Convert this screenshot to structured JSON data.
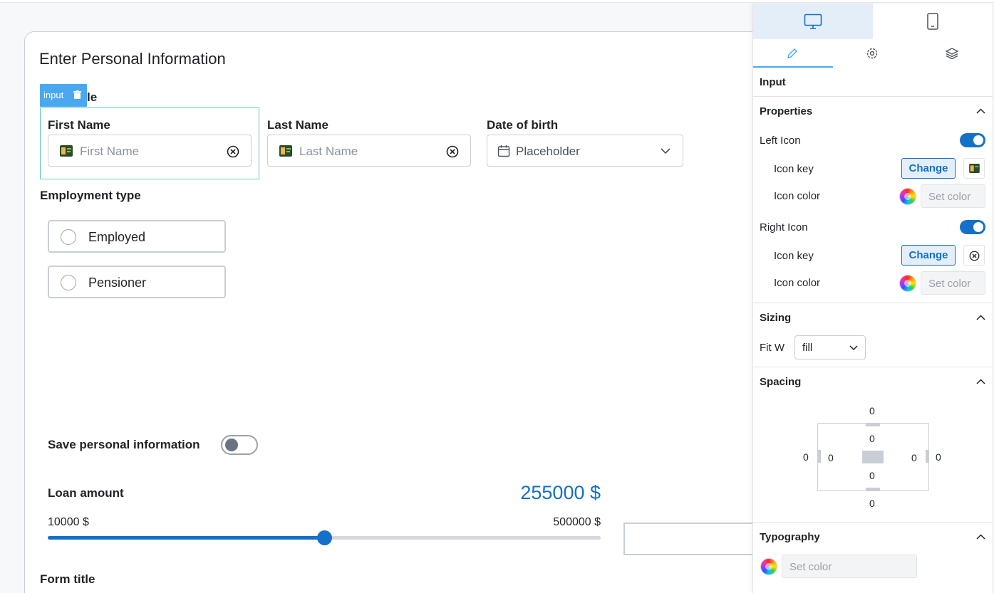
{
  "form": {
    "heading": "Enter Personal Information",
    "selection_tag": "input",
    "behind_title_fragment": "le",
    "first_name": {
      "label": "First Name",
      "placeholder": "First Name"
    },
    "last_name": {
      "label": "Last Name",
      "placeholder": "Last Name"
    },
    "dob": {
      "label": "Date of birth",
      "placeholder": "Placeholder"
    },
    "employment": {
      "label": "Employment type",
      "options": [
        "Employed",
        "Pensioner"
      ]
    },
    "save_info": {
      "label": "Save personal information",
      "enabled": false
    },
    "loan": {
      "label": "Loan amount",
      "value_text": "255000 $",
      "min_text": "10000 $",
      "max_text": "500000 $",
      "value": 255000,
      "min": 10000,
      "max": 500000
    },
    "footer_title": "Form title"
  },
  "panel": {
    "device_tabs": [
      "desktop-icon",
      "mobile-icon"
    ],
    "tool_tabs": [
      "pencil-icon",
      "gear-icon",
      "layers-icon"
    ],
    "component_title": "Input",
    "properties": {
      "title": "Properties",
      "left_icon": {
        "label": "Left Icon",
        "enabled": true,
        "icon_key_label": "Icon key",
        "change_label": "Change",
        "icon_color_label": "Icon color",
        "set_color_label": "Set color"
      },
      "right_icon": {
        "label": "Right Icon",
        "enabled": true,
        "icon_key_label": "Icon key",
        "change_label": "Change",
        "icon_color_label": "Icon color",
        "set_color_label": "Set color"
      }
    },
    "sizing": {
      "title": "Sizing",
      "fit_w_label": "Fit W",
      "fit_w_value": "fill"
    },
    "spacing": {
      "title": "Spacing",
      "margin_top": "0",
      "margin_bottom": "0",
      "margin_left": "0",
      "margin_right": "0",
      "padding_top": "0",
      "padding_bottom": "0",
      "padding_left": "0",
      "padding_right": "0"
    },
    "typography": {
      "title": "Typography",
      "set_color_label": "Set color"
    }
  },
  "colors": {
    "accent": "#1570c8",
    "selection": "#4aa8f0",
    "selected_outline": "#5ec9c4"
  }
}
